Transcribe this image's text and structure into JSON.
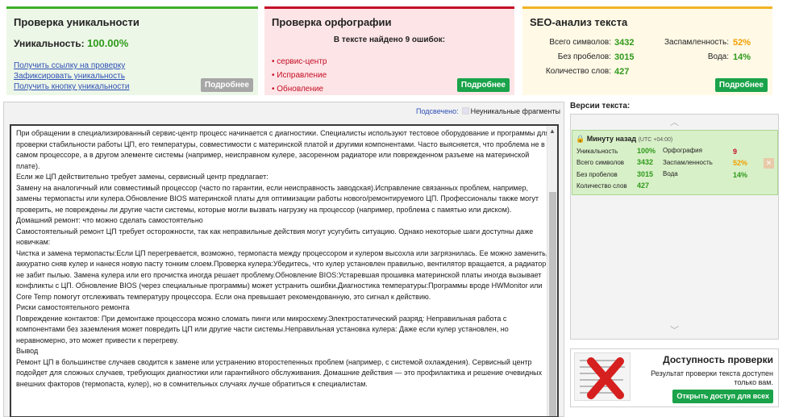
{
  "uniqueness": {
    "title": "Проверка уникальности",
    "label": "Уникальность:",
    "value": "100.00%",
    "links": [
      "Получить ссылку на проверку",
      "Зафиксировать уникальность",
      "Получить кнопку уникальности"
    ],
    "more_label": "Подробнее"
  },
  "spelling": {
    "title": "Проверка орфографии",
    "summary": "В тексте найдено 9 ошибок:",
    "errors": [
      "сервис-центр",
      "Исправление",
      "Обновление"
    ],
    "more_label": "Подробнее"
  },
  "seo": {
    "title": "SEO-анализ текста",
    "rows": [
      {
        "label": "Всего символов:",
        "value": "3432",
        "label2": "Заспамленность:",
        "value2": "52%",
        "value2_color": "#f0a000"
      },
      {
        "label": "Без пробелов:",
        "value": "3015",
        "label2": "Вода:",
        "value2": "14%",
        "value2_color": "#2e9a1a"
      },
      {
        "label": "Количество слов:",
        "value": "427",
        "label2": "",
        "value2": "",
        "value2_color": "#2e9a1a"
      }
    ],
    "more_label": "Подробнее"
  },
  "highlight": {
    "label": "Подсвечено:",
    "legend": "Неуникальные фрагменты"
  },
  "text": {
    "paragraphs": [
      "При обращении в специализированный сервис-центр процесс начинается с диагностики. Специалисты используют тестовое оборудование и программы для проверки стабильности работы ЦП, его температуры, совместимости с материнской платой и другими компонентами. Часто выясняется, что проблема не в самом процессоре, а в другом элементе системы (например, неисправном кулере, засоренном радиаторе или поврежденном разъеме на материнской плате).",
      "Если же ЦП действительно требует замены, сервисный центр предлагает:",
      "Замену на аналогичный или совместимый процессор (часто по гарантии, если неисправность заводская).Исправление связанных проблем, например, замены термопасты или кулера.Обновление BIOS материнской платы для оптимизации работы нового/ремонтируемого ЦП. Профессионалы также могут проверить, не повреждены ли другие части системы, которые могли вызвать нагрузку на процессор (например, проблема с памятью или диском).",
      "Домашний ремонт: что можно сделать самостоятельно",
      "Самостоятельный ремонт ЦП требует осторожности, так как неправильные действия могут усугубить ситуацию. Однако некоторые шаги доступны даже новичкам:",
      "Чистка и замена термопасты:Если ЦП перегревается, возможно, термопаста между процессором и кулером высохла или загрязнилась. Ее можно заменить, аккуратно сняв кулер и нанеся новую пасту тонким слоем.Проверка кулера:Убедитесь, что кулер установлен правильно, вентилятор вращается, а радиатор не забит пылью. Замена кулера или его прочистка иногда решает проблему.Обновление BIOS:Устаревшая прошивка материнской платы иногда вызывает конфликты с ЦП. Обновление BIOS (через специальные программы) может устранить ошибки.Диагностика температуры:Программы вроде HWMonitor или Core Temp помогут отслеживать температуру процессора. Если она превышает рекомендованную, это сигнал к действию.",
      "Риски самостоятельного ремонта",
      "Повреждение контактов: При демонтаже процессора можно сломать пинги или микросхему.Электростатический разряд: Неправильная работа с компонентами без заземления может повредить ЦП или другие части системы.Неправильная установка кулера: Даже если кулер установлен, но неравномерно, это может привести к перегреву.",
      "Вывод",
      "Ремонт ЦП в большинстве случаев сводится к замене или устранению второстепенных проблем (например, с системой охлаждения). Сервисный центр подойдет для сложных случаев, требующих диагностики или гарантийного обслуживания. Домашние действия — это профилактика и решение очевидных внешних факторов (термопаста, кулер), но в сомнительных случаях лучше обратиться к специалистам."
    ]
  },
  "versions": {
    "title": "Версии текста:",
    "item": {
      "time": "Минуту назад",
      "tz": "(UTC +04:00)",
      "uniq_label": "Уникальность",
      "uniq_value": "100%",
      "chars_label": "Всего символов",
      "chars_value": "3432",
      "nospace_label": "Без пробелов",
      "nospace_value": "3015",
      "words_label": "Количество слов",
      "words_value": "427",
      "spell_label": "Орфография",
      "spell_value": "9",
      "spam_label": "Заспамленность",
      "spam_value": "52%",
      "water_label": "Вода",
      "water_value": "14%"
    },
    "colors": {
      "spell": "#c40d24",
      "spam": "#f0a000",
      "ok": "#2e9a1a"
    }
  },
  "availability": {
    "title": "Доступность проверки",
    "text": "Результат проверки текста доступен только вам.",
    "button": "Открыть доступ для всех"
  }
}
